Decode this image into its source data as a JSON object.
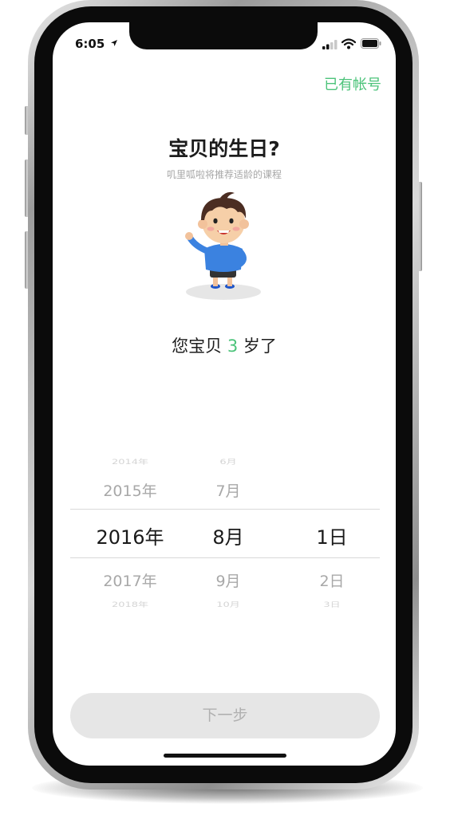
{
  "status_bar": {
    "time": "6:05"
  },
  "header": {
    "login_link": "已有帐号"
  },
  "content": {
    "title": "宝贝的生日?",
    "subtitle": "叽里呱啦将推荐适龄的课程",
    "age_prefix": "您宝贝",
    "age_value": "3",
    "age_suffix": "岁了"
  },
  "picker": {
    "years": [
      "2014年",
      "2015年",
      "2016年",
      "2017年",
      "2018年"
    ],
    "months": [
      "6月",
      "7月",
      "8月",
      "9月",
      "10月"
    ],
    "days": [
      "1日",
      "2日",
      "3日"
    ],
    "selected": {
      "year": "2016年",
      "month": "8月",
      "day": "1日"
    }
  },
  "footer": {
    "next_button": "下一步"
  },
  "colors": {
    "accent": "#4cc37a",
    "button_disabled_bg": "#e6e6e6",
    "button_disabled_text": "#b0b0b0"
  },
  "icons": [
    "location-arrow-icon",
    "signal-icon",
    "wifi-icon",
    "battery-icon"
  ]
}
